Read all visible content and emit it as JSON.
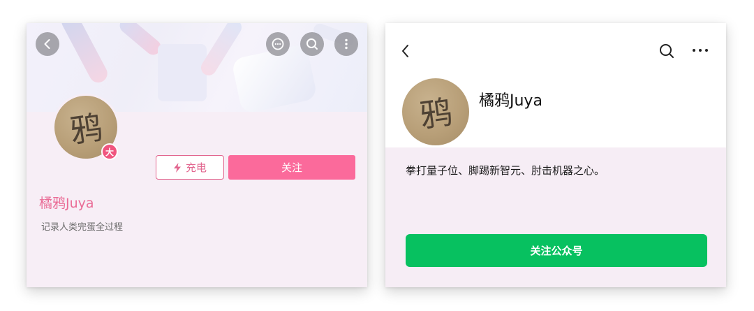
{
  "left_card": {
    "avatar_char": "鸦",
    "badge": "大",
    "charge_label": "充电",
    "follow_label": "关注",
    "name": "橘鸦Juya",
    "signature": "记录人类完蛋全过程",
    "icons": {
      "back": "chevron-left-icon",
      "message": "chat-bubble-icon",
      "search": "search-icon",
      "more": "more-vertical-icon",
      "charge": "lightning-icon"
    },
    "colors": {
      "accent": "#fb6a9b",
      "name": "#ea6c96"
    }
  },
  "right_card": {
    "avatar_char": "鸦",
    "name": "橘鸦Juya",
    "description": "拳打量子位、脚踢新智元、肘击机器之心。",
    "follow_label": "关注公众号",
    "icons": {
      "back": "chevron-left-icon",
      "search": "search-icon",
      "more": "more-horizontal-icon"
    },
    "colors": {
      "button": "#07c160"
    }
  }
}
